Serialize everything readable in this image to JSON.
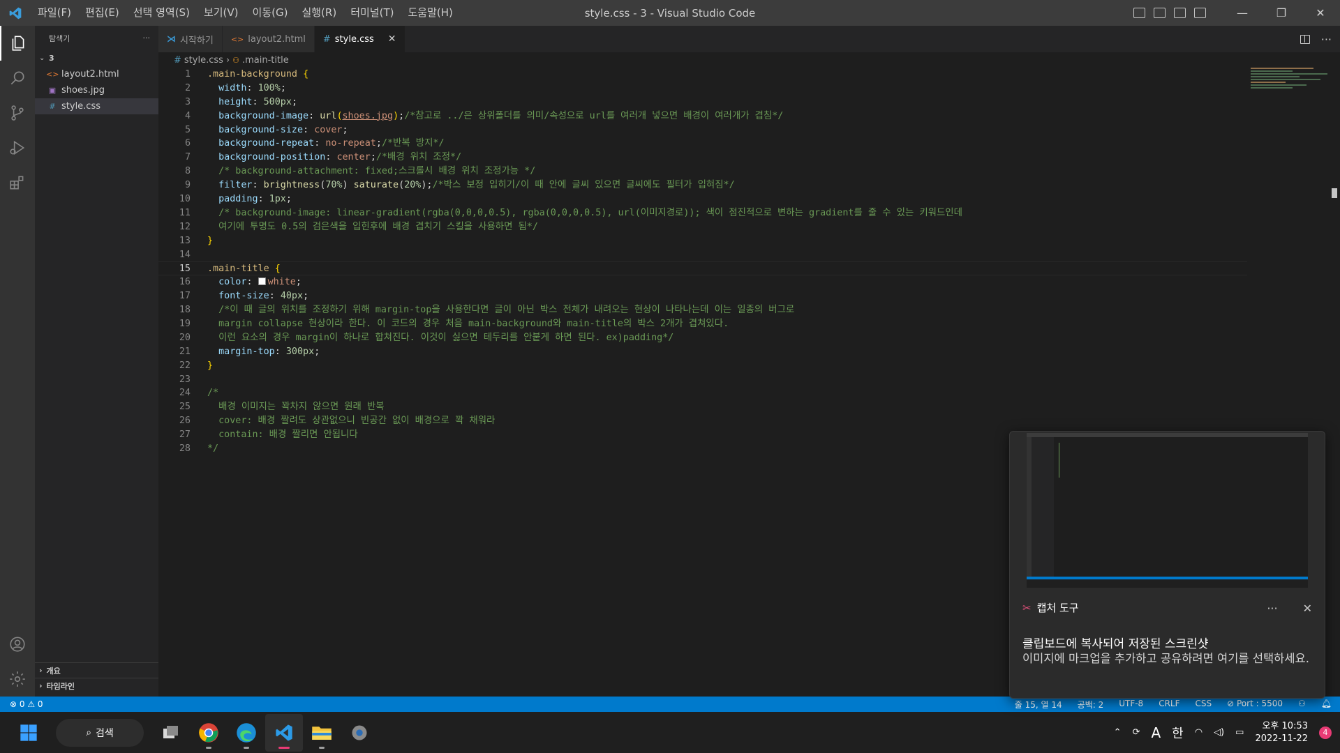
{
  "window": {
    "title": "style.css - 3 - Visual Studio Code",
    "menu": [
      "파일(F)",
      "편집(E)",
      "선택 영역(S)",
      "보기(V)",
      "이동(G)",
      "실행(R)",
      "터미널(T)",
      "도움말(H)"
    ],
    "minimize": "—",
    "maximize": "❐",
    "close": "✕"
  },
  "sidebar": {
    "header": "탐색기",
    "more": "···",
    "folder": "3",
    "files": [
      {
        "name": "layout2.html",
        "icon": "<>",
        "icon_color": "#e37933"
      },
      {
        "name": "shoes.jpg",
        "icon": "▣",
        "icon_color": "#a074c4"
      },
      {
        "name": "style.css",
        "icon": "#",
        "icon_color": "#519aba"
      }
    ],
    "outline": "개요",
    "timeline": "타임라인"
  },
  "tabs": [
    {
      "label": "시작하기",
      "icon": "vscode-icon"
    },
    {
      "label": "layout2.html",
      "icon": "<>"
    },
    {
      "label": "style.css",
      "icon": "#",
      "close": "✕"
    }
  ],
  "breadcrumb": {
    "file": "style.css",
    "symbol": ".main-title"
  },
  "editor": {
    "current_line": 15,
    "lines": [
      [
        {
          "t": ".main-background ",
          "c": "sel-c"
        },
        {
          "t": "{",
          "c": "br"
        }
      ],
      [
        {
          "t": "  "
        },
        {
          "t": "width",
          "c": "prop"
        },
        {
          "t": ": "
        },
        {
          "t": "100%",
          "c": "num"
        },
        {
          "t": ";"
        }
      ],
      [
        {
          "t": "  "
        },
        {
          "t": "height",
          "c": "prop"
        },
        {
          "t": ": "
        },
        {
          "t": "500px",
          "c": "num"
        },
        {
          "t": ";"
        }
      ],
      [
        {
          "t": "  "
        },
        {
          "t": "background-image",
          "c": "prop"
        },
        {
          "t": ": "
        },
        {
          "t": "url",
          "c": "fn"
        },
        {
          "t": "(",
          "c": "br"
        },
        {
          "t": "shoes.jpg",
          "c": "link"
        },
        {
          "t": ")",
          "c": "br"
        },
        {
          "t": ";"
        },
        {
          "t": "/*참고로 ../은 상위폴더를 의미/속성으로 url를 여러개 넣으면 배경이 여러개가 겹침*/",
          "c": "cm"
        }
      ],
      [
        {
          "t": "  "
        },
        {
          "t": "background-size",
          "c": "prop"
        },
        {
          "t": ": "
        },
        {
          "t": "cover",
          "c": "val"
        },
        {
          "t": ";"
        }
      ],
      [
        {
          "t": "  "
        },
        {
          "t": "background-repeat",
          "c": "prop"
        },
        {
          "t": ": "
        },
        {
          "t": "no-repeat",
          "c": "val"
        },
        {
          "t": ";"
        },
        {
          "t": "/*반복 방지*/",
          "c": "cm"
        }
      ],
      [
        {
          "t": "  "
        },
        {
          "t": "background-position",
          "c": "prop"
        },
        {
          "t": ": "
        },
        {
          "t": "center",
          "c": "val"
        },
        {
          "t": ";"
        },
        {
          "t": "/*배경 위치 조정*/",
          "c": "cm"
        }
      ],
      [
        {
          "t": "  "
        },
        {
          "t": "/* background-attachment: fixed;스크롤시 배경 위치 조정가능 */",
          "c": "cm"
        }
      ],
      [
        {
          "t": "  "
        },
        {
          "t": "filter",
          "c": "prop"
        },
        {
          "t": ": "
        },
        {
          "t": "brightness",
          "c": "fn"
        },
        {
          "t": "("
        },
        {
          "t": "70%",
          "c": "num"
        },
        {
          "t": ") "
        },
        {
          "t": "saturate",
          "c": "fn"
        },
        {
          "t": "("
        },
        {
          "t": "20%",
          "c": "num"
        },
        {
          "t": ");"
        },
        {
          "t": "/*박스 보정 입히기/이 때 안에 글씨 있으면 글씨에도 필터가 입혀짐*/",
          "c": "cm"
        }
      ],
      [
        {
          "t": "  "
        },
        {
          "t": "padding",
          "c": "prop"
        },
        {
          "t": ": "
        },
        {
          "t": "1px",
          "c": "num"
        },
        {
          "t": ";"
        }
      ],
      [
        {
          "t": "  "
        },
        {
          "t": "/* background-image: linear-gradient(rgba(0,0,0,0.5), rgba(0,0,0,0.5), url(이미지경로)); 색이 점진적으로 변하는 gradient를 줄 수 있는 키워드인데",
          "c": "cm"
        }
      ],
      [
        {
          "t": "  "
        },
        {
          "t": "여기에 투명도 0.5의 검은색을 입힌후에 배경 겹치기 스킬을 사용하면 됨*/",
          "c": "cm"
        }
      ],
      [
        {
          "t": "}",
          "c": "br"
        }
      ],
      [
        {
          "t": ""
        }
      ],
      [
        {
          "t": ".main-title ",
          "c": "sel-c"
        },
        {
          "t": "{",
          "c": "br"
        }
      ],
      [
        {
          "t": "  "
        },
        {
          "t": "color",
          "c": "prop"
        },
        {
          "t": ": "
        },
        {
          "t": "",
          "c": "swatch"
        },
        {
          "t": "white",
          "c": "val"
        },
        {
          "t": ";"
        }
      ],
      [
        {
          "t": "  "
        },
        {
          "t": "font-size",
          "c": "prop"
        },
        {
          "t": ": "
        },
        {
          "t": "40px",
          "c": "num"
        },
        {
          "t": ";"
        }
      ],
      [
        {
          "t": "  "
        },
        {
          "t": "/*이 때 글의 위치를 조정하기 위해 margin-top을 사용한다면 글이 아닌 박스 전체가 내려오는 현상이 나타나는데 이는 일종의 버그로",
          "c": "cm"
        }
      ],
      [
        {
          "t": "  "
        },
        {
          "t": "margin collapse 현상이라 한다. 이 코드의 경우 처음 main-background와 main-title의 박스 2개가 겹쳐있다.",
          "c": "cm"
        }
      ],
      [
        {
          "t": "  "
        },
        {
          "t": "이런 요소의 경우 margin이 하나로 합쳐진다. 이것이 싫으면 테두리를 안붙게 하면 된다. ex)padding*/",
          "c": "cm"
        }
      ],
      [
        {
          "t": "  "
        },
        {
          "t": "margin-top",
          "c": "prop"
        },
        {
          "t": ": "
        },
        {
          "t": "300px",
          "c": "num"
        },
        {
          "t": ";"
        }
      ],
      [
        {
          "t": "}",
          "c": "br"
        }
      ],
      [
        {
          "t": ""
        }
      ],
      [
        {
          "t": "/*",
          "c": "cm"
        }
      ],
      [
        {
          "t": "  배경 이미지는 꽉차지 않으면 원래 반복",
          "c": "cm"
        }
      ],
      [
        {
          "t": "  cover: 배경 짤려도 상관없으니 빈공간 없이 배경으로 꽉 채워라",
          "c": "cm"
        }
      ],
      [
        {
          "t": "  contain: 배경 짤리면 안됩니다",
          "c": "cm"
        }
      ],
      [
        {
          "t": "*/",
          "c": "cm"
        }
      ]
    ]
  },
  "statusbar": {
    "problems": "⊗ 0 ⚠ 0",
    "position": "줄 15, 열 14",
    "spaces": "공백: 2",
    "encoding": "UTF-8",
    "eol": "CRLF",
    "language": "CSS",
    "port": "⊘ Port : 5500"
  },
  "taskbar": {
    "search": "검색",
    "time": "오후 10:53",
    "date": "2022-11-22",
    "notifications": "4",
    "ime_a": "A",
    "ime_han": "한"
  },
  "toast": {
    "app": "캡처 도구",
    "more": "···",
    "close": "✕",
    "title": "클립보드에 복사되어 저장된 스크린샷",
    "body": "이미지에 마크업을 추가하고 공유하려면 여기를 선택하세요."
  },
  "colors": {
    "accent": "#007acc",
    "titlebar": "#3c3c3c",
    "activitybar": "#333333",
    "sidebar": "#252526",
    "editor": "#1e1e1e"
  }
}
